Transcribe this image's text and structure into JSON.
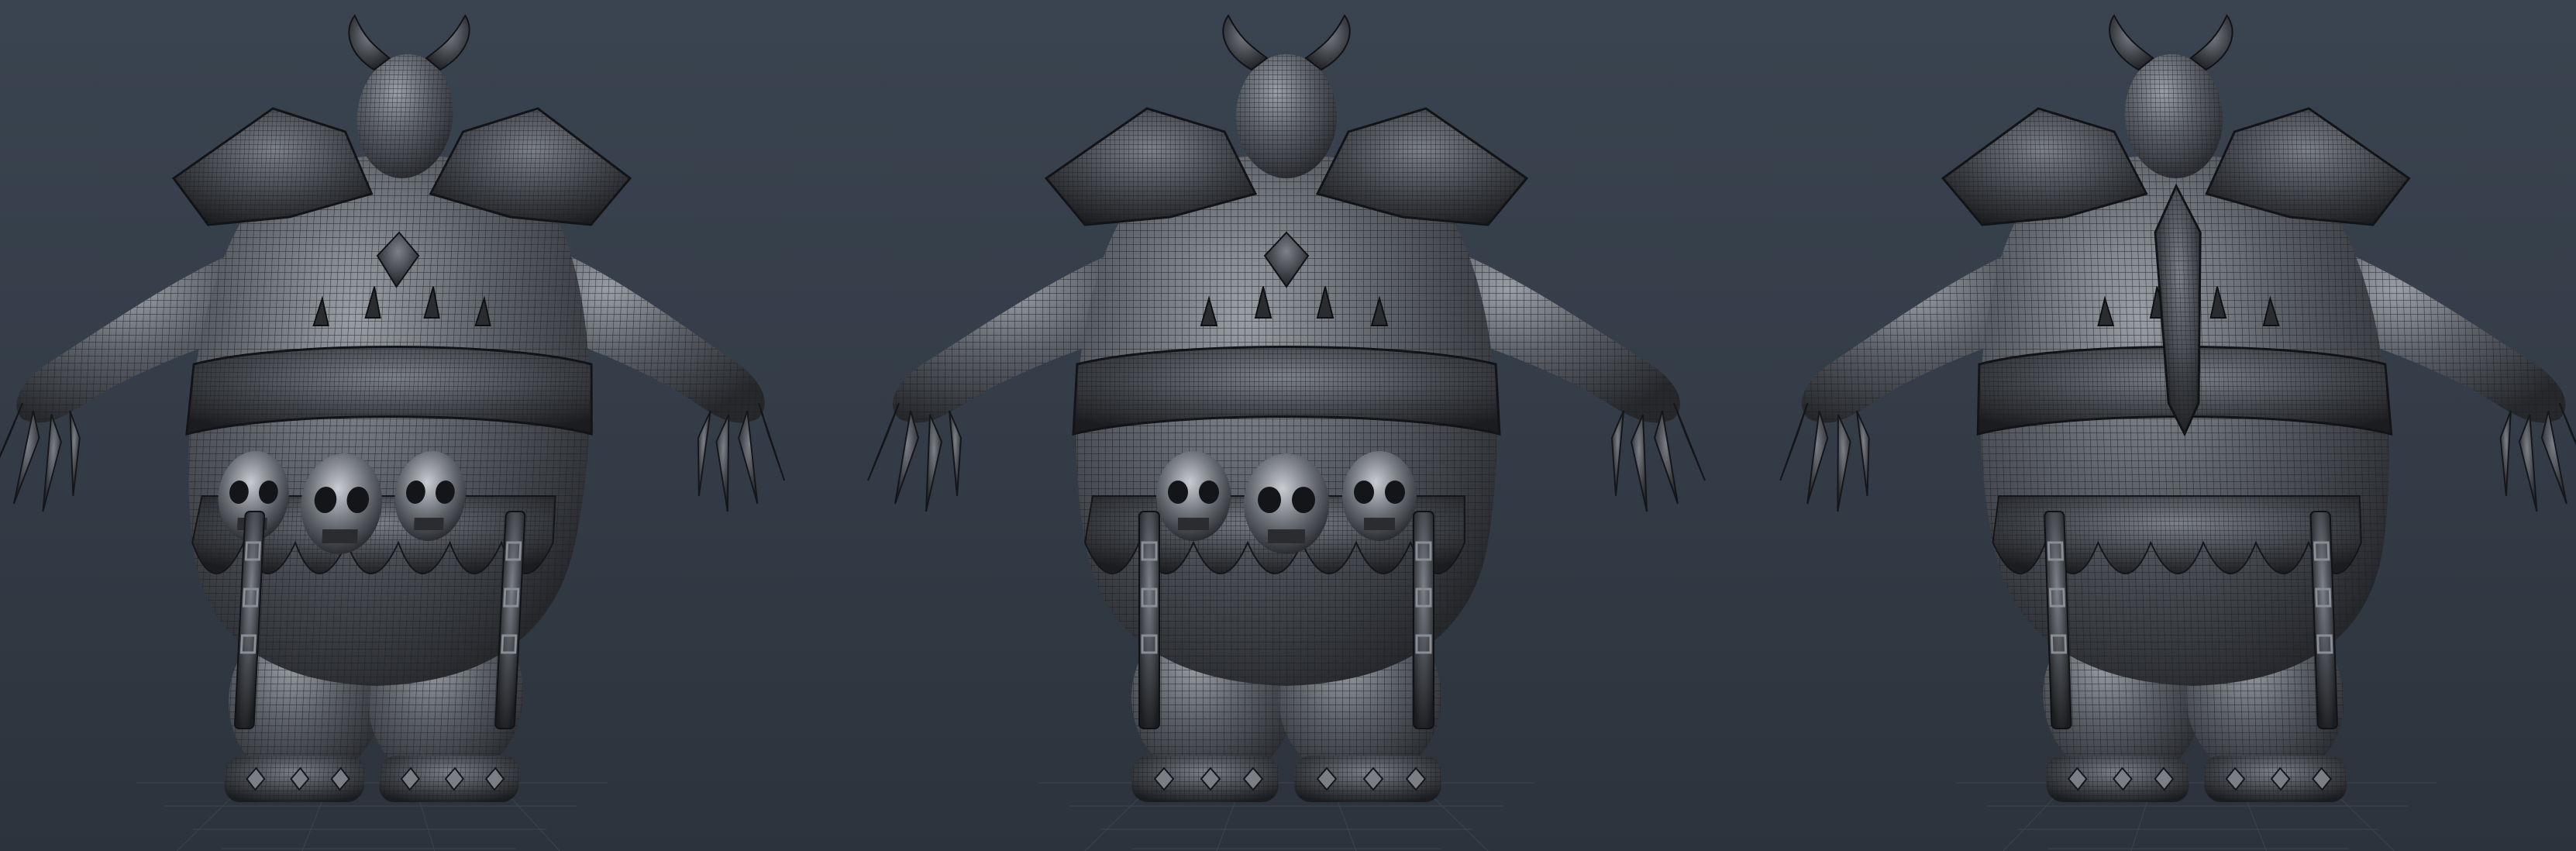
{
  "scene": {
    "background_top": "#3a4450",
    "background_bottom": "#2c333c",
    "mesh_color": "#4a4d52",
    "wire_color": "#1c1d20",
    "highlight_color": "#b8bcc2",
    "views": [
      {
        "name": "three-quarter-front-view"
      },
      {
        "name": "front-view"
      },
      {
        "name": "back-view"
      }
    ]
  }
}
